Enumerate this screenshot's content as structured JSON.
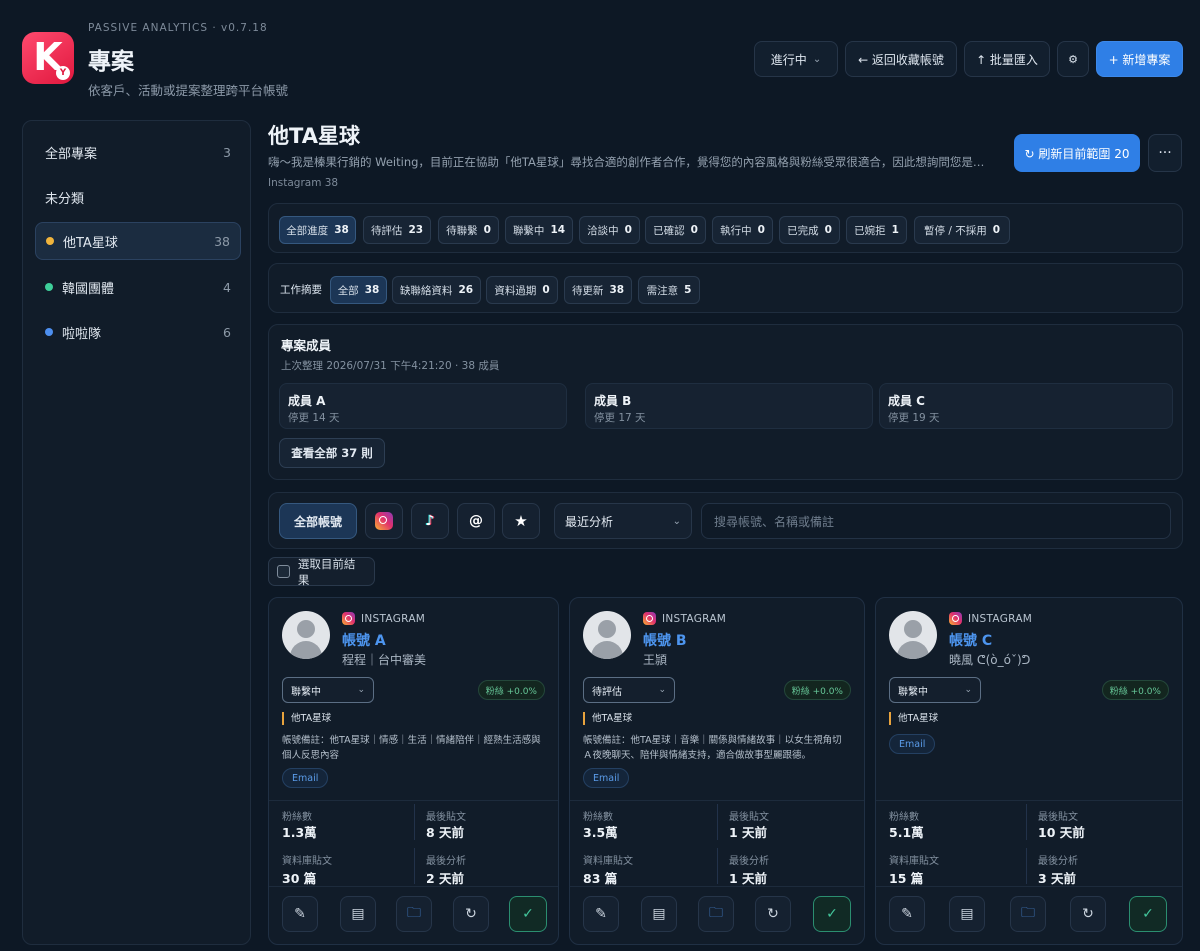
{
  "app": {
    "version": "PASSIVE ANALYTICS · v0.7.18",
    "title": "專案",
    "subtitle": "依客戶、活動或提案整理跨平台帳號",
    "logo_letter": "K",
    "logo_badge": "Y"
  },
  "header": {
    "status_select": "進行中",
    "back_label": "← 返回收藏帳號",
    "import_label": "↑ 批量匯入",
    "settings_icon": "⚙",
    "new_label": "+ 新增專案"
  },
  "sidebar": {
    "items": [
      {
        "label": "全部專案",
        "count": "3",
        "color": ""
      },
      {
        "label": "未分類",
        "count": "",
        "color": ""
      },
      {
        "label": "他TA星球",
        "count": "38",
        "color": "#f0b43c"
      },
      {
        "label": "韓國團體",
        "count": "4",
        "color": "#3ecf9a"
      },
      {
        "label": "啦啦隊",
        "count": "6",
        "color": "#4d8ff0"
      }
    ]
  },
  "project": {
    "title": "他TA星球",
    "description": "嗨～我是榛果行銷的 Weiting，目前正在協助「他TA星球」尋找合適的創作者合作，覺得您的內容風格與粉絲受眾很適合，因此想詢問您是…",
    "meta": "Instagram 38",
    "refresh_label": "↻ 刷新目前範圍 20",
    "more_icon": "···"
  },
  "progress_filters": [
    {
      "label": "全部進度",
      "count": "38"
    },
    {
      "label": "待評估",
      "count": "23"
    },
    {
      "label": "待聯繫",
      "count": "0"
    },
    {
      "label": "聯繫中",
      "count": "14"
    },
    {
      "label": "洽談中",
      "count": "0"
    },
    {
      "label": "已確認",
      "count": "0"
    },
    {
      "label": "執行中",
      "count": "0"
    },
    {
      "label": "已完成",
      "count": "0"
    },
    {
      "label": "已婉拒",
      "count": "1"
    },
    {
      "label": "暫停 / 不採用",
      "count": "0"
    }
  ],
  "work_summary": {
    "label": "工作摘要",
    "filters": [
      {
        "label": "全部",
        "count": "38"
      },
      {
        "label": "缺聯絡資料",
        "count": "26"
      },
      {
        "label": "資料過期",
        "count": "0"
      },
      {
        "label": "待更新",
        "count": "38"
      },
      {
        "label": "需注意",
        "count": "5"
      }
    ]
  },
  "members": {
    "title": "專案成員",
    "subtitle": "上次整理 2026/07/31 下午4:21:20 · 38 成員",
    "cards": [
      {
        "name": "成員 A",
        "sub": "停更 14 天"
      },
      {
        "name": "成員 B",
        "sub": "停更 17 天"
      },
      {
        "name": "成員 C",
        "sub": "停更 19 天"
      }
    ],
    "view_all": "查看全部 37 則"
  },
  "account_filter": {
    "all_label": "全部帳號",
    "sort_select": "最近分析",
    "search_placeholder": "搜尋帳號、名稱或備註"
  },
  "select_all_label": "選取目前結果",
  "accounts": [
    {
      "platform": "INSTAGRAM",
      "name": "帳號 A",
      "sub": "程程｜台中審美",
      "status": "聯繫中",
      "fans_badge": "粉絲 +0.0%",
      "tag": "他TA星球",
      "note": "帳號備註：他TA星球｜情感｜生活｜情緒陪伴｜經熟生活感與個人反思內容",
      "email": "Email",
      "stats": {
        "followers_label": "粉絲數",
        "followers": "1.3萬",
        "last_post_label": "最後貼文",
        "last_post": "8 天前",
        "db_posts_label": "資料庫貼文",
        "db_posts": "30 篇",
        "last_analysis_label": "最後分析",
        "last_analysis": "2 天前"
      }
    },
    {
      "platform": "INSTAGRAM",
      "name": "帳號 B",
      "sub": "王頴",
      "status": "待評估",
      "fans_badge": "粉絲 +0.0%",
      "tag": "他TA星球",
      "note": "帳號備註：他TA星球｜音樂｜關係與情緒故事｜以女生視角切Ａ夜晚聊天、陪伴與情緒支持，適合做故事型麗跟德。",
      "email": "Email",
      "stats": {
        "followers_label": "粉絲數",
        "followers": "3.5萬",
        "last_post_label": "最後貼文",
        "last_post": "1 天前",
        "db_posts_label": "資料庫貼文",
        "db_posts": "83 篇",
        "last_analysis_label": "最後分析",
        "last_analysis": "1 天前"
      }
    },
    {
      "platform": "INSTAGRAM",
      "name": "帳號 C",
      "sub": "曉風 ᕦ(ò_óˇ)ᕤ",
      "status": "聯繫中",
      "fans_badge": "粉絲 +0.0%",
      "tag": "他TA星球",
      "note": "",
      "email": "Email",
      "stats": {
        "followers_label": "粉絲數",
        "followers": "5.1萬",
        "last_post_label": "最後貼文",
        "last_post": "10 天前",
        "db_posts_label": "資料庫貼文",
        "db_posts": "15 篇",
        "last_analysis_label": "最後分析",
        "last_analysis": "3 天前"
      }
    }
  ],
  "card_actions": {
    "edit_icon": "✎",
    "notes_icon": "▤",
    "folder_icon": "🗀",
    "refresh_icon": "↻",
    "confirm_icon": "✓"
  }
}
